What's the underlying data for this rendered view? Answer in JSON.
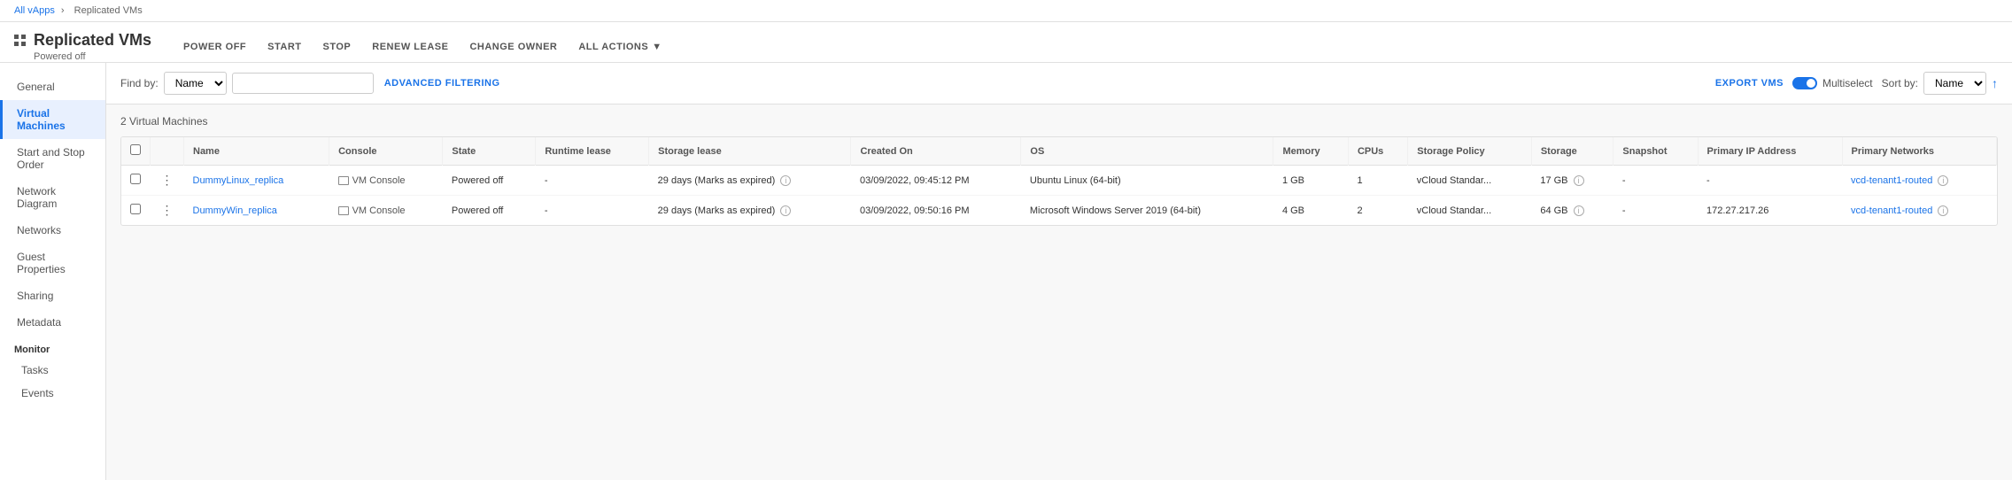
{
  "breadcrumb": {
    "parent": "All vApps",
    "current": "Replicated VMs"
  },
  "page_title": "Replicated VMs",
  "page_subtitle": "Powered off",
  "toolbar_actions": [
    {
      "id": "power-off",
      "label": "POWER OFF"
    },
    {
      "id": "start",
      "label": "START"
    },
    {
      "id": "stop",
      "label": "STOP"
    },
    {
      "id": "renew-lease",
      "label": "RENEW LEASE"
    },
    {
      "id": "change-owner",
      "label": "CHANGE OWNER"
    },
    {
      "id": "all-actions",
      "label": "ALL ACTIONS"
    }
  ],
  "sidebar": {
    "items": [
      {
        "id": "general",
        "label": "General"
      },
      {
        "id": "virtual-machines",
        "label": "Virtual Machines",
        "active": true
      },
      {
        "id": "start-stop-order",
        "label": "Start and Stop Order"
      },
      {
        "id": "network-diagram",
        "label": "Network Diagram"
      },
      {
        "id": "networks",
        "label": "Networks"
      },
      {
        "id": "guest-properties",
        "label": "Guest Properties"
      },
      {
        "id": "sharing",
        "label": "Sharing"
      },
      {
        "id": "metadata",
        "label": "Metadata"
      }
    ],
    "monitor_section": "Monitor",
    "monitor_items": [
      {
        "id": "tasks",
        "label": "Tasks"
      },
      {
        "id": "events",
        "label": "Events"
      }
    ]
  },
  "filter": {
    "find_by_label": "Find by:",
    "find_by_value": "Name",
    "advanced_filter_label": "ADVANCED FILTERING",
    "sort_by_label": "Sort by:",
    "sort_by_value": "Name"
  },
  "vm_count_label": "2 Virtual Machines",
  "export_label": "EXPORT VMS",
  "multiselect_label": "Multiselect",
  "table": {
    "columns": [
      {
        "id": "name",
        "label": "Name"
      },
      {
        "id": "console",
        "label": "Console"
      },
      {
        "id": "state",
        "label": "State"
      },
      {
        "id": "runtime-lease",
        "label": "Runtime lease"
      },
      {
        "id": "storage-lease",
        "label": "Storage lease"
      },
      {
        "id": "created-on",
        "label": "Created On"
      },
      {
        "id": "os",
        "label": "OS"
      },
      {
        "id": "memory",
        "label": "Memory"
      },
      {
        "id": "cpus",
        "label": "CPUs"
      },
      {
        "id": "storage-policy",
        "label": "Storage Policy"
      },
      {
        "id": "storage",
        "label": "Storage"
      },
      {
        "id": "snapshot",
        "label": "Snapshot"
      },
      {
        "id": "primary-ip",
        "label": "Primary IP Address"
      },
      {
        "id": "primary-networks",
        "label": "Primary Networks"
      }
    ],
    "rows": [
      {
        "name": "DummyLinux_replica",
        "console": "VM Console",
        "state": "Powered off",
        "runtime_lease": "-",
        "storage_lease": "29 days (Marks as expired)",
        "created_on": "03/09/2022, 09:45:12 PM",
        "os": "Ubuntu Linux (64-bit)",
        "memory": "1 GB",
        "cpus": "1",
        "storage_policy": "vCloud Standar...",
        "storage": "17 GB",
        "snapshot": "-",
        "primary_ip": "-",
        "primary_networks": "vcd-tenant1-routed"
      },
      {
        "name": "DummyWin_replica",
        "console": "VM Console",
        "state": "Powered off",
        "runtime_lease": "-",
        "storage_lease": "29 days (Marks as expired)",
        "created_on": "03/09/2022, 09:50:16 PM",
        "os": "Microsoft Windows Server 2019 (64-bit)",
        "memory": "4 GB",
        "cpus": "2",
        "storage_policy": "vCloud Standar...",
        "storage": "64 GB",
        "snapshot": "-",
        "primary_ip": "172.27.217.26",
        "primary_networks": "vcd-tenant1-routed"
      }
    ]
  }
}
